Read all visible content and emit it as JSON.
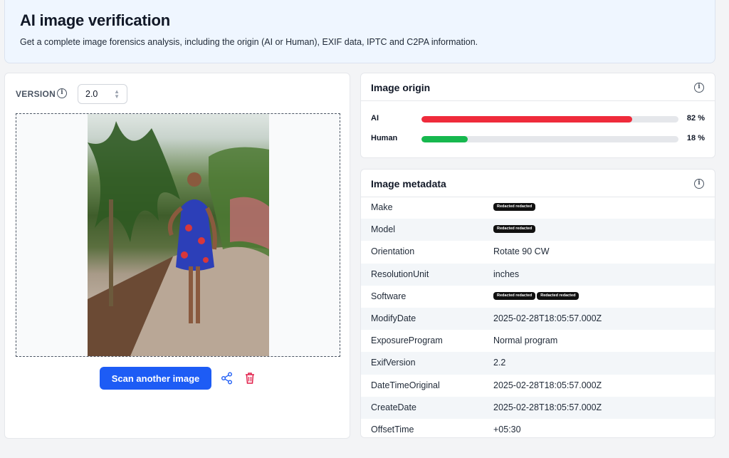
{
  "header": {
    "title": "AI image verification",
    "subtitle": "Get a complete image forensics analysis, including the origin (AI or Human), EXIF data, IPTC and C2PA information."
  },
  "version": {
    "label": "VERSION",
    "value": "2.0",
    "info_icon": "info-icon"
  },
  "actions": {
    "scan_label": "Scan another image",
    "share_icon": "share-icon",
    "delete_icon": "trash-icon"
  },
  "origin": {
    "title": "Image origin",
    "rows": [
      {
        "label": "AI",
        "percent": 82,
        "percent_label": "82 %",
        "color": "#ef2b3b"
      },
      {
        "label": "Human",
        "percent": 18,
        "percent_label": "18 %",
        "color": "#16b84e"
      }
    ]
  },
  "metadata": {
    "title": "Image metadata",
    "redacted_text": "Redacted redacted",
    "rows": [
      {
        "key": "Make",
        "value": "",
        "redacted": 1
      },
      {
        "key": "Model",
        "value": "",
        "redacted": 1
      },
      {
        "key": "Orientation",
        "value": "Rotate 90 CW"
      },
      {
        "key": "ResolutionUnit",
        "value": "inches"
      },
      {
        "key": "Software",
        "value": "",
        "redacted": 2
      },
      {
        "key": "ModifyDate",
        "value": "2025-02-28T18:05:57.000Z"
      },
      {
        "key": "ExposureProgram",
        "value": "Normal program"
      },
      {
        "key": "ExifVersion",
        "value": "2.2"
      },
      {
        "key": "DateTimeOriginal",
        "value": "2025-02-28T18:05:57.000Z"
      },
      {
        "key": "CreateDate",
        "value": "2025-02-28T18:05:57.000Z"
      },
      {
        "key": "OffsetTime",
        "value": "+05:30"
      }
    ]
  },
  "colors": {
    "accent": "#1d5cf5",
    "ai_bar": "#ef2b3b",
    "human_bar": "#16b84e",
    "delete": "#e11d48"
  }
}
